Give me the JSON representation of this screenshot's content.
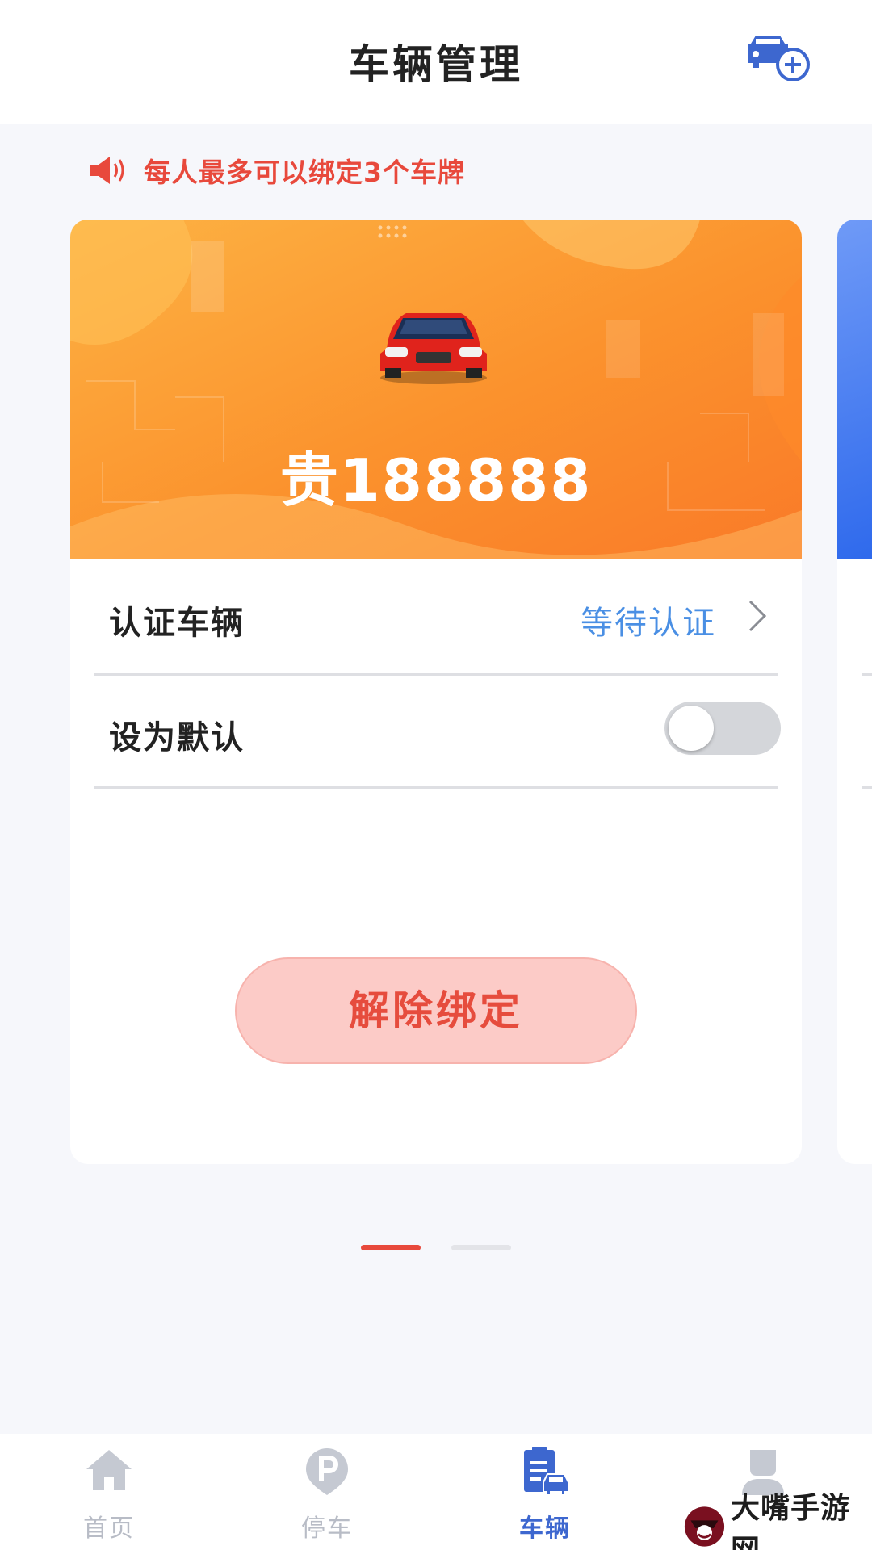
{
  "header": {
    "title": "车辆管理",
    "add_icon": "car-add-icon"
  },
  "notice": {
    "icon": "speaker-icon",
    "text": "每人最多可以绑定3个车牌"
  },
  "card": {
    "car_icon": "red-car-image",
    "plate": "贵188888",
    "verify_label": "认证车辆",
    "verify_status": "等待认证",
    "default_label": "设为默认",
    "default_on": false,
    "unbind_label": "解除绑定"
  },
  "pager": {
    "current": 1,
    "total": 2
  },
  "tabbar": [
    {
      "label": "首页",
      "icon": "home-icon",
      "active": false
    },
    {
      "label": "停车",
      "icon": "parking-icon",
      "active": false
    },
    {
      "label": "车辆",
      "icon": "vehicle-doc-icon",
      "active": true
    },
    {
      "label": "",
      "icon": "user-icon",
      "active": false
    }
  ],
  "colors": {
    "accent": "#3d67cf",
    "notice_red": "#e8493c",
    "banner_orange": "#fb8d2c",
    "status_blue": "#4a8fe4",
    "unbind_bg": "#fccbc7"
  },
  "watermark": {
    "text": "大嘴手游网"
  }
}
